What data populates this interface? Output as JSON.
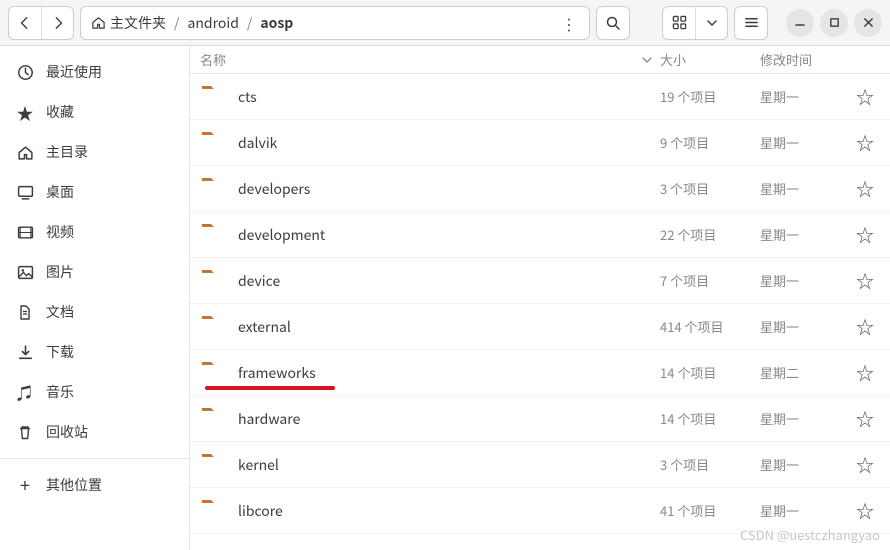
{
  "breadcrumb": {
    "home_label": "主文件夹",
    "segments": [
      "android",
      "aosp"
    ]
  },
  "sidebar": {
    "items": [
      {
        "icon": "clock",
        "label": "最近使用"
      },
      {
        "icon": "star",
        "label": "收藏"
      },
      {
        "icon": "home",
        "label": "主目录"
      },
      {
        "icon": "desktop",
        "label": "桌面"
      },
      {
        "icon": "video",
        "label": "视频"
      },
      {
        "icon": "image",
        "label": "图片"
      },
      {
        "icon": "document",
        "label": "文档"
      },
      {
        "icon": "download",
        "label": "下载"
      },
      {
        "icon": "music",
        "label": "音乐"
      },
      {
        "icon": "trash",
        "label": "回收站"
      }
    ],
    "other_label": "其他位置"
  },
  "columns": {
    "name": "名称",
    "size": "大小",
    "modified": "修改时间"
  },
  "rows": [
    {
      "name": "cts",
      "size": "19 个项目",
      "modified": "星期一",
      "highlight": false
    },
    {
      "name": "dalvik",
      "size": "9 个项目",
      "modified": "星期一",
      "highlight": false
    },
    {
      "name": "developers",
      "size": "3 个项目",
      "modified": "星期一",
      "highlight": false
    },
    {
      "name": "development",
      "size": "22 个项目",
      "modified": "星期一",
      "highlight": false
    },
    {
      "name": "device",
      "size": "7 个项目",
      "modified": "星期一",
      "highlight": false
    },
    {
      "name": "external",
      "size": "414 个项目",
      "modified": "星期一",
      "highlight": false
    },
    {
      "name": "frameworks",
      "size": "14 个项目",
      "modified": "星期二",
      "highlight": true
    },
    {
      "name": "hardware",
      "size": "14 个项目",
      "modified": "星期一",
      "highlight": false
    },
    {
      "name": "kernel",
      "size": "3 个项目",
      "modified": "星期一",
      "highlight": false
    },
    {
      "name": "libcore",
      "size": "41 个项目",
      "modified": "星期一",
      "highlight": false
    }
  ],
  "watermark": "CSDN @uestczhangyao"
}
